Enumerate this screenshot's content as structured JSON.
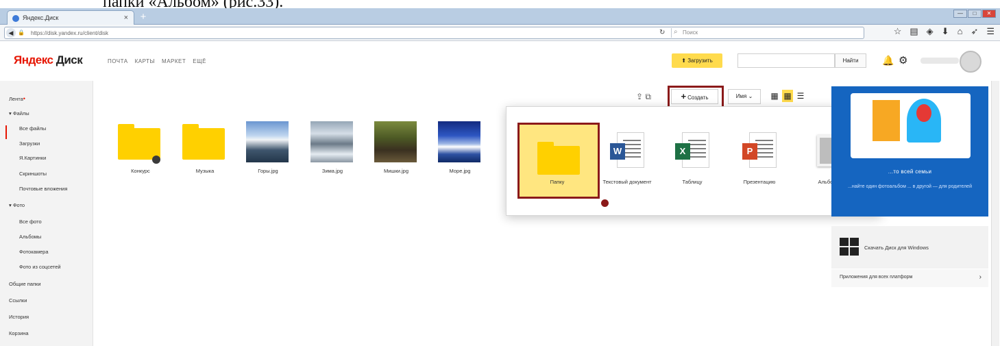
{
  "caption": "папки «Альбом» (рис.33).",
  "browser": {
    "tab_title": "Яндекс.Диск",
    "tab_close": "×",
    "new_tab": "+",
    "url": "https://disk.yandex.ru/client/disk",
    "search_placeholder": "Поиск",
    "win_min": "—",
    "win_max": "□",
    "win_close": "✕"
  },
  "header": {
    "logo_main": "Яндекс",
    "logo_sub": " Диск",
    "services": [
      "ПОЧТА",
      "КАРТЫ",
      "МАРКЕТ",
      "ЕЩЁ"
    ],
    "upload_label": "Загрузить",
    "find_label": "Найти"
  },
  "sidebar": {
    "lenta": "Лента",
    "files_section": "Файлы",
    "files_items": [
      "Все файлы",
      "Загрузки",
      "Я.Картинки",
      "Скриншоты",
      "Почтовые вложения"
    ],
    "photo_section": "Фото",
    "photo_items": [
      "Все фото",
      "Альбомы",
      "Фотокамера",
      "Фото из соцсетей"
    ],
    "other_items": [
      "Общие папки",
      "Ссылки",
      "История",
      "Корзина"
    ]
  },
  "toolbar": {
    "create_label": "Создать",
    "sort_label": "Имя"
  },
  "files": [
    {
      "name": "Конкурс",
      "kind": "folder",
      "shared": true
    },
    {
      "name": "Музыка",
      "kind": "folder",
      "shared": false
    },
    {
      "name": "Горы.jpg",
      "kind": "photo-mountains"
    },
    {
      "name": "Зима.jpg",
      "kind": "photo-winter"
    },
    {
      "name": "Мишки.jpg",
      "kind": "photo-bear"
    },
    {
      "name": "Море.jpg",
      "kind": "photo-sea"
    }
  ],
  "create_menu": {
    "items": [
      {
        "label": "Папку",
        "icon": "folder-icon"
      },
      {
        "label": "Текстовый документ",
        "icon": "word-doc-icon"
      },
      {
        "label": "Таблицу",
        "icon": "excel-sheet-icon"
      },
      {
        "label": "Презентацию",
        "icon": "powerpoint-icon"
      },
      {
        "label": "Альбом",
        "icon": "album-icon"
      }
    ]
  },
  "right_panel": {
    "banner_title": "...то всей семьи",
    "banner_text": "...найте один фотоальбом ... в другой — для родителей",
    "windows_label": "Скачать Диск для Windows",
    "apps_label": "Приложения для всех платформ",
    "apps_arrow": "›"
  },
  "colors": {
    "accent_yellow": "#ffdb4d",
    "highlight_red": "#8b1a1a",
    "brand_red": "#e61400",
    "banner_blue": "#1565c0"
  }
}
